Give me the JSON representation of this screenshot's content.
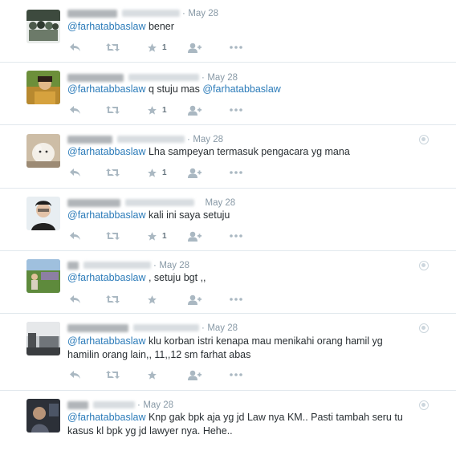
{
  "tweets": [
    {
      "name": "Philf Ds Silva",
      "handle": "@pmsantil",
      "date": "May 28",
      "mention": "@farhatabbaslaw",
      "text": " bener",
      "favorites": "1",
      "show_caret": false,
      "avatar_color": "#5a6a55"
    },
    {
      "name": "Linda Kristina",
      "handle": "@linda_linda",
      "date": "May 28",
      "mention": "@farhatabbaslaw",
      "text": " q stuju mas ",
      "mention2": "@farhatabbaslaw",
      "favorites": "1",
      "show_caret": false,
      "avatar_color": "#c08a3a"
    },
    {
      "name": "Jangifoo",
      "handle": "@dutapangdan",
      "date": "May 28",
      "mention": "@farhatabbaslaw",
      "text": " Lha sampeyan termasuk pengacara yg mana",
      "favorites": "1",
      "show_caret": true,
      "avatar_color": "#d8c9b6"
    },
    {
      "name": "Danang Yonik",
      "handle": "@DanangYonik",
      "date": "May 28",
      "mention": "@farhatabbaslaw",
      "text": " kali ini saya setuju",
      "favorites": "1",
      "show_caret": false,
      "avatar_color": "#3b3b3b"
    },
    {
      "name": "fo",
      "handle": "@farosta2110",
      "date": "May 28",
      "mention": "@farhatabbaslaw",
      "text": " , setuju bgt ,,",
      "favorites": "",
      "show_caret": true,
      "avatar_color": "#6f8f4f"
    },
    {
      "name": "ATIK NGAMI",
      "handle": "@tigisellilik",
      "date": "May 28",
      "mention": "@farhatabbaslaw",
      "text": " klu korban istri kenapa mau menikahi orang hamil yg hamilin orang lain,, 11,,12 sm farhat abas",
      "favorites": "",
      "show_caret": true,
      "avatar_color": "#8a8f93"
    },
    {
      "name": "ACD",
      "handle": "@acdaridi",
      "date": "May 28",
      "mention": "@farhatabbaslaw",
      "text": " Knp gak bpk aja yg jd Law nya KM.. Pasti tambah seru tu kasus kl bpk yg jd lawyer nya. Hehe..",
      "favorites": "",
      "show_caret": true,
      "avatar_color": "#4a4f58"
    }
  ]
}
